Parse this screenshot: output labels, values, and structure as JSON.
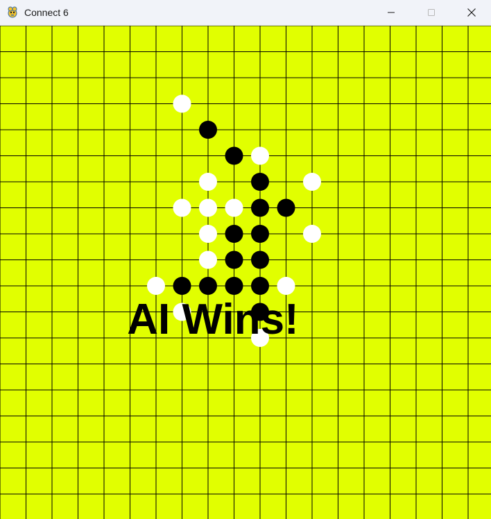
{
  "window": {
    "title": "Connect 6",
    "icon": "pygame-snake-icon",
    "controls": {
      "minimize_icon": "minimize-icon",
      "maximize_icon": "maximize-icon",
      "close_icon": "close-icon"
    }
  },
  "game": {
    "board_color": "#e1ff00",
    "line_color": "#000000",
    "black_stone_color": "#000000",
    "white_stone_color": "#ffffff",
    "result_text": "AI Wins!",
    "result_text_color": "#000000",
    "stones": {
      "black": [
        [
          8,
          4
        ],
        [
          9,
          5
        ],
        [
          10,
          6
        ],
        [
          10,
          7
        ],
        [
          11,
          7
        ],
        [
          9,
          8
        ],
        [
          10,
          8
        ],
        [
          9,
          9
        ],
        [
          10,
          9
        ],
        [
          7,
          10
        ],
        [
          8,
          10
        ],
        [
          9,
          10
        ],
        [
          10,
          10
        ],
        [
          10,
          11
        ]
      ],
      "white": [
        [
          7,
          3
        ],
        [
          10,
          5
        ],
        [
          8,
          6
        ],
        [
          12,
          6
        ],
        [
          7,
          7
        ],
        [
          8,
          7
        ],
        [
          9,
          7
        ],
        [
          8,
          8
        ],
        [
          12,
          8
        ],
        [
          8,
          9
        ],
        [
          6,
          10
        ],
        [
          11,
          10
        ],
        [
          7,
          11
        ],
        [
          10,
          12
        ]
      ]
    }
  }
}
